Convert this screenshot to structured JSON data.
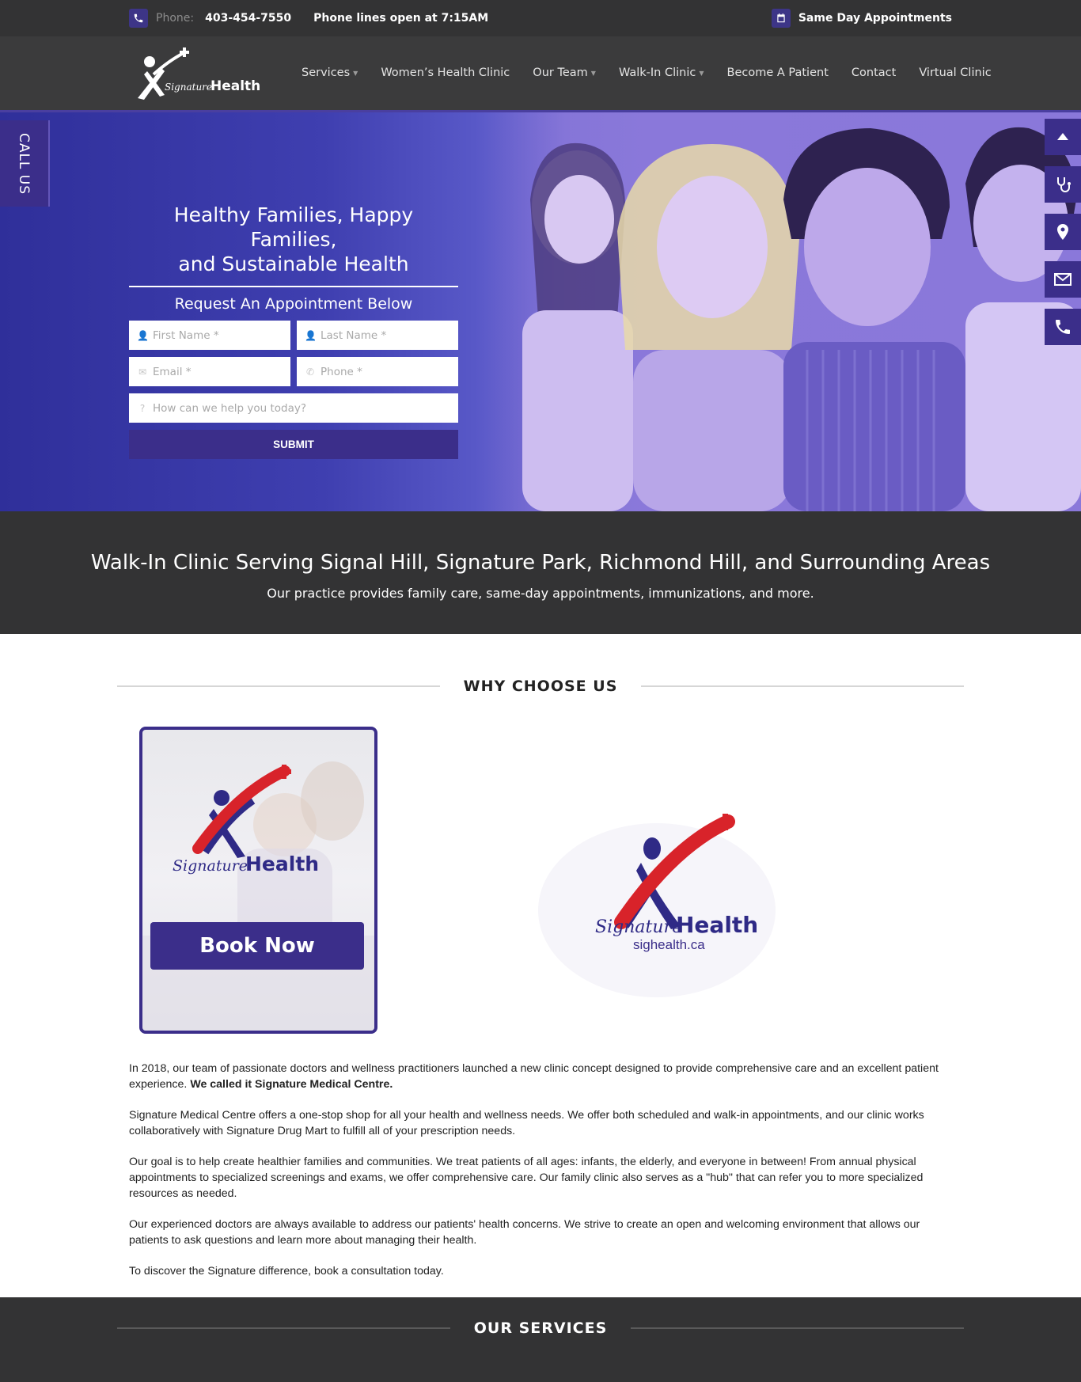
{
  "topbar": {
    "phone_label": "Phone:",
    "phone_number": "403-454-7550",
    "hours": "Phone lines open at 7:15AM",
    "same_day": "Same Day Appointments"
  },
  "nav": {
    "items": [
      {
        "label": "Services",
        "dropdown": true
      },
      {
        "label": "Women’s Health Clinic",
        "dropdown": false
      },
      {
        "label": "Our Team",
        "dropdown": true
      },
      {
        "label": "Walk-In Clinic",
        "dropdown": true
      },
      {
        "label": "Become A Patient",
        "dropdown": false
      },
      {
        "label": "Contact",
        "dropdown": false
      },
      {
        "label": "Virtual Clinic",
        "dropdown": false
      }
    ]
  },
  "logo": {
    "script": "Signature",
    "word": "Health"
  },
  "hero": {
    "title_line1": "Healthy Families, Happy Families,",
    "title_line2": "and Sustainable Health",
    "subtitle": "Request An Appointment Below",
    "first_name_ph": "First Name *",
    "last_name_ph": "Last Name *",
    "email_ph": "Email *",
    "phone_ph": "Phone *",
    "message_ph": "How can we help you today?",
    "submit": "SUBMIT"
  },
  "callus": "CALL US",
  "band": {
    "heading": "Walk-In Clinic Serving Signal Hill, Signature Park, Richmond Hill, and Surrounding Areas",
    "sub": "Our practice provides family care, same-day appointments, immunizations, and more."
  },
  "why": {
    "title": "WHY CHOOSE US",
    "book_now": "Book Now",
    "card_logo_script": "Signature",
    "card_logo_word": "Health",
    "big_logo_script": "Signature",
    "big_logo_word": "Health",
    "big_logo_url": "sighealth.ca"
  },
  "content": {
    "p1": "In 2018, our team of passionate doctors and wellness practitioners launched a new clinic concept designed to provide comprehensive care and an excellent patient experience.",
    "p1_bold": "We called it Signature Medical Centre.",
    "p2": "Signature Medical Centre offers a one-stop shop for all your health and wellness needs. We offer both scheduled and walk-in appointments, and our clinic works collaboratively with Signature Drug Mart to fulfill all of your prescription needs.",
    "p3": "Our goal is to help create healthier families and communities. We treat patients of all ages: infants, the elderly, and everyone in between! From annual physical appointments to specialized screenings and exams, we offer comprehensive care. Our family clinic also serves as a \"hub\" that can refer you to more specialized resources as needed.",
    "p4": "Our experienced doctors are always available to address our patients' health concerns. We strive to create an open and welcoming environment that allows our patients to ask questions and learn more about managing their health.",
    "p5": "To discover the Signature difference, book a consultation today."
  },
  "services": {
    "title": "OUR SERVICES"
  },
  "colors": {
    "brand_purple": "#3b2e8a",
    "dark_bar": "#333334",
    "accent_red": "#d8232a"
  }
}
